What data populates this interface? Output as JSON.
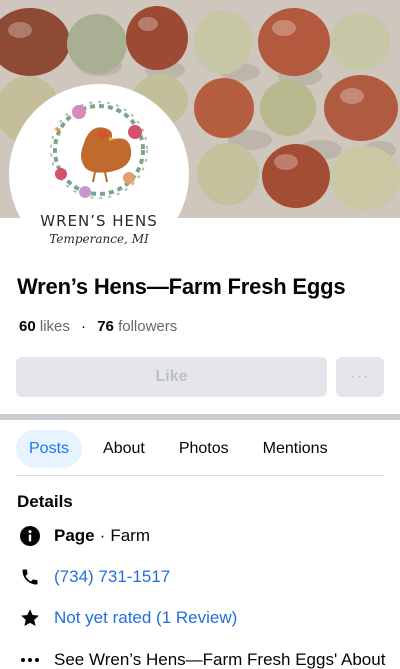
{
  "page": {
    "name": "Wren’s Hens—Farm Fresh Eggs",
    "likes_count": "60",
    "likes_label": "likes",
    "followers_count": "76",
    "followers_label": "followers",
    "separator_dot": "·"
  },
  "avatar": {
    "brand_name": "WREN’S HENS",
    "brand_location": "Temperance, MI"
  },
  "actions": {
    "like_label": "Like",
    "more_label": "···"
  },
  "tabs": [
    {
      "label": "Posts",
      "active": true
    },
    {
      "label": "About",
      "active": false
    },
    {
      "label": "Photos",
      "active": false
    },
    {
      "label": "Mentions",
      "active": false
    }
  ],
  "details": {
    "heading": "Details",
    "category_label": "Page",
    "category_sep": "·",
    "category_value": "Farm",
    "phone": "(734) 731-1517",
    "rating": "Not yet rated (1 Review)",
    "see_about": "See Wren’s Hens—Farm Fresh Eggs' About"
  },
  "icons": {
    "info": "info-icon",
    "phone": "phone-icon",
    "star": "star-icon",
    "more": "more-dots-icon"
  },
  "colors": {
    "accent": "#1877f2",
    "link": "#216fdb",
    "button_bg": "#e4e6eb",
    "button_text_disabled": "#bcc0c4",
    "tab_active_bg": "#e7f3ff",
    "muted_text": "#65676b"
  }
}
